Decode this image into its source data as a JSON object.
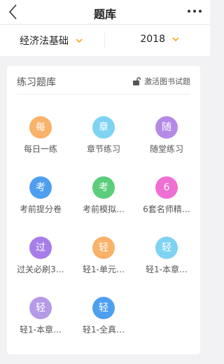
{
  "nav": {
    "title": "题库",
    "back_icon": "chevron-left-icon",
    "more_icon": "more-dots-icon"
  },
  "filter": {
    "subject": "经济法基础",
    "year": "2018",
    "accent": "#f5a623"
  },
  "bank": {
    "title": "练习题库",
    "activate_label": "激活图书试题",
    "items": [
      {
        "glyph": "每",
        "label": "每日一练",
        "color": "#f8b26a"
      },
      {
        "glyph": "章",
        "label": "章节练习",
        "color": "#7fd3f2"
      },
      {
        "glyph": "随",
        "label": "随堂练习",
        "color": "#b48ae6"
      },
      {
        "glyph": "考",
        "label": "考前提分卷",
        "color": "#4f9ff0"
      },
      {
        "glyph": "考",
        "label": "考前模拟…",
        "color": "#5ccd7a"
      },
      {
        "glyph": "6",
        "label": "6套名师精…",
        "color": "#ef6fd3"
      },
      {
        "glyph": "过",
        "label": "过关必刷3…",
        "color": "#a77ee8"
      },
      {
        "glyph": "轻",
        "label": "轻1-单元…",
        "color": "#f8b26a"
      },
      {
        "glyph": "轻",
        "label": "轻1-本章…",
        "color": "#7fd3f2"
      },
      {
        "glyph": "轻",
        "label": "轻1-本章…",
        "color": "#b59ae8"
      },
      {
        "glyph": "轻",
        "label": "轻1-全真…",
        "color": "#4f9ff0"
      }
    ]
  }
}
